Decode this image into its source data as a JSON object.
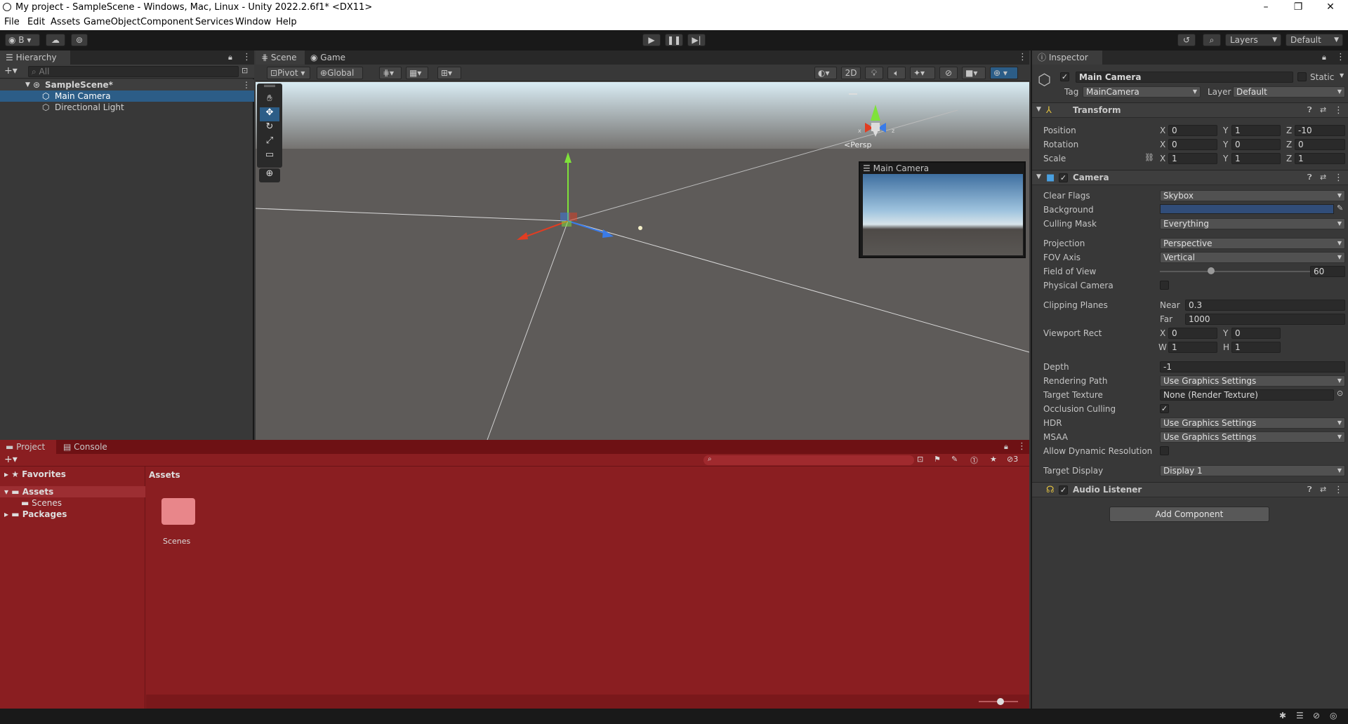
{
  "title_bar": {
    "title": "My project - SampleScene - Windows, Mac, Linux - Unity 2022.2.6f1* <DX11>"
  },
  "menu": [
    "File",
    "Edit",
    "Assets",
    "GameObject",
    "Component",
    "Services",
    "Window",
    "Help"
  ],
  "toolbar": {
    "account": "B",
    "layers": "Layers",
    "layout": "Default"
  },
  "hierarchy": {
    "tab": "Hierarchy",
    "search_placeholder": "All",
    "scene": "SampleScene*",
    "items": [
      "Main Camera",
      "Directional Light"
    ]
  },
  "scene_view": {
    "tabs": [
      "Scene",
      "Game"
    ],
    "pivot": "Pivot",
    "global": "Global",
    "mode_2d": "2D",
    "persp": "Persp",
    "camera_preview_title": "Main Camera"
  },
  "inspector": {
    "tab": "Inspector",
    "object_name": "Main Camera",
    "static_label": "Static",
    "tag_label": "Tag",
    "tag": "MainCamera",
    "layer_label": "Layer",
    "layer": "Default",
    "transform": {
      "title": "Transform",
      "position_label": "Position",
      "position": [
        "0",
        "1",
        "-10"
      ],
      "rotation_label": "Rotation",
      "rotation": [
        "0",
        "0",
        "0"
      ],
      "scale_label": "Scale",
      "scale": [
        "1",
        "1",
        "1"
      ]
    },
    "camera": {
      "title": "Camera",
      "clear_flags_label": "Clear Flags",
      "clear_flags": "Skybox",
      "background_label": "Background",
      "background_color": "#314d79",
      "culling_mask_label": "Culling Mask",
      "culling_mask": "Everything",
      "projection_label": "Projection",
      "projection": "Perspective",
      "fov_axis_label": "FOV Axis",
      "fov_axis": "Vertical",
      "fov_label": "Field of View",
      "fov": "60",
      "fov_fraction": 0.33,
      "physical_label": "Physical Camera",
      "clipping_label": "Clipping Planes",
      "near_label": "Near",
      "near": "0.3",
      "far_label": "Far",
      "far": "1000",
      "viewport_label": "Viewport Rect",
      "vx": "0",
      "vy": "0",
      "vw": "1",
      "vh": "1",
      "depth_label": "Depth",
      "depth": "-1",
      "rendering_path_label": "Rendering Path",
      "rendering_path": "Use Graphics Settings",
      "target_texture_label": "Target Texture",
      "target_texture": "None (Render Texture)",
      "occlusion_label": "Occlusion Culling",
      "hdr_label": "HDR",
      "hdr": "Use Graphics Settings",
      "msaa_label": "MSAA",
      "msaa": "Use Graphics Settings",
      "dynres_label": "Allow Dynamic Resolution",
      "target_display_label": "Target Display",
      "target_display": "Display 1"
    },
    "audio_listener": {
      "title": "Audio Listener"
    },
    "add_component": "Add Component"
  },
  "project": {
    "tabs": [
      "Project",
      "Console"
    ],
    "favorites": "Favorites",
    "assets": "Assets",
    "scenes": "Scenes",
    "packages": "Packages",
    "breadcrumb": "Assets",
    "folder": "Scenes",
    "hidden_count": "3"
  }
}
